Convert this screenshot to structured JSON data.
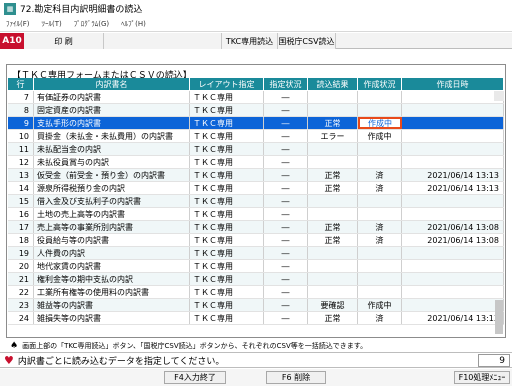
{
  "window": {
    "title": "72.勘定科目内訳明細書の読込",
    "app_icon": "spreadsheet-icon"
  },
  "menubar": {
    "items": [
      "ﾌｧｲﾙ(F)",
      "ﾂｰﾙ(T)",
      "ﾌﾟﾛｸﾞﾗﾑ(G)",
      "ﾍﾙﾌﾟ(H)"
    ]
  },
  "toolbar": {
    "code": "A10",
    "print_label": "印  刷",
    "tkc_read_label": "TKC専用読込",
    "nta_csv_label": "国税庁CSV読込",
    "code_color": "#c8102e"
  },
  "panel": {
    "title": "【ＴＫＣ専用フォームまたはＣＳＶの読込】"
  },
  "table": {
    "headers": {
      "no": "行",
      "name": "内訳書名",
      "layout": "レイアウト指定",
      "spec": "指定状況",
      "result": "読込結果",
      "status": "作成状況",
      "date": "作成日時"
    },
    "header_color": "#1a8a9a",
    "rows": [
      {
        "no": "7",
        "name": "有価証券の内訳書",
        "layout": "ＴＫＣ専用",
        "spec": "―",
        "result": "",
        "status": "",
        "date": ""
      },
      {
        "no": "8",
        "name": "固定資産の内訳書",
        "layout": "ＴＫＣ専用",
        "spec": "―",
        "result": "",
        "status": "",
        "date": ""
      },
      {
        "no": "9",
        "name": "支払手形の内訳書",
        "layout": "ＴＫＣ専用",
        "spec": "―",
        "result": "正常",
        "status": "作成中",
        "date": ""
      },
      {
        "no": "10",
        "name": "買掛金（未払金・未払費用）の内訳書",
        "layout": "ＴＫＣ専用",
        "spec": "―",
        "result": "エラー",
        "status": "作成中",
        "date": ""
      },
      {
        "no": "11",
        "name": "未払配当金の内訳",
        "layout": "ＴＫＣ専用",
        "spec": "―",
        "result": "",
        "status": "",
        "date": ""
      },
      {
        "no": "12",
        "name": "未払役員賞与の内訳",
        "layout": "ＴＫＣ専用",
        "spec": "―",
        "result": "",
        "status": "",
        "date": ""
      },
      {
        "no": "13",
        "name": "仮受金（前受金・預り金）の内訳書",
        "layout": "ＴＫＣ専用",
        "spec": "―",
        "result": "正常",
        "status": "済",
        "date": "2021/06/14 13:13"
      },
      {
        "no": "14",
        "name": "源泉所得税預り金の内訳",
        "layout": "ＴＫＣ専用",
        "spec": "―",
        "result": "正常",
        "status": "済",
        "date": "2021/06/14 13:13"
      },
      {
        "no": "15",
        "name": "借入金及び支払利子の内訳書",
        "layout": "ＴＫＣ専用",
        "spec": "―",
        "result": "",
        "status": "",
        "date": ""
      },
      {
        "no": "16",
        "name": "土地の売上高等の内訳書",
        "layout": "ＴＫＣ専用",
        "spec": "―",
        "result": "",
        "status": "",
        "date": ""
      },
      {
        "no": "17",
        "name": "売上高等の事業所別内訳書",
        "layout": "ＴＫＣ専用",
        "spec": "―",
        "result": "正常",
        "status": "済",
        "date": "2021/06/14 13:08"
      },
      {
        "no": "18",
        "name": "役員給与等の内訳書",
        "layout": "ＴＫＣ専用",
        "spec": "―",
        "result": "正常",
        "status": "済",
        "date": "2021/06/14 13:08"
      },
      {
        "no": "19",
        "name": "人件費の内訳",
        "layout": "ＴＫＣ専用",
        "spec": "―",
        "result": "",
        "status": "",
        "date": ""
      },
      {
        "no": "20",
        "name": "地代家賃の内訳書",
        "layout": "ＴＫＣ専用",
        "spec": "―",
        "result": "",
        "status": "",
        "date": ""
      },
      {
        "no": "21",
        "name": "権利金等の期中支払の内訳",
        "layout": "ＴＫＣ専用",
        "spec": "―",
        "result": "",
        "status": "",
        "date": ""
      },
      {
        "no": "22",
        "name": "工業所有権等の使用料の内訳書",
        "layout": "ＴＫＣ専用",
        "spec": "―",
        "result": "",
        "status": "",
        "date": ""
      },
      {
        "no": "23",
        "name": "雑益等の内訳書",
        "layout": "ＴＫＣ専用",
        "spec": "―",
        "result": "要確認",
        "status": "作成中",
        "date": ""
      },
      {
        "no": "24",
        "name": "雑損失等の内訳書",
        "layout": "ＴＫＣ専用",
        "spec": "―",
        "result": "正常",
        "status": "済",
        "date": "2021/06/14 13:13"
      }
    ],
    "selected_row_color": "#0c64d8"
  },
  "info": {
    "icon": "spade-icon",
    "text": "画面上部の「TKC専用読込」ボタン、「国税庁CSV読込」ボタンから、それぞれのCSV等を一括読込できます。"
  },
  "status": {
    "icon": "heart-icon",
    "text": "内訳書ごとに読み込むデータを指定してください。",
    "page": "9",
    "heart_color": "#c8102e"
  },
  "fkeys": {
    "f4": "F4入力終了",
    "f6": "F6 削除",
    "f10": "F10処理ﾒﾆｭｰ"
  }
}
